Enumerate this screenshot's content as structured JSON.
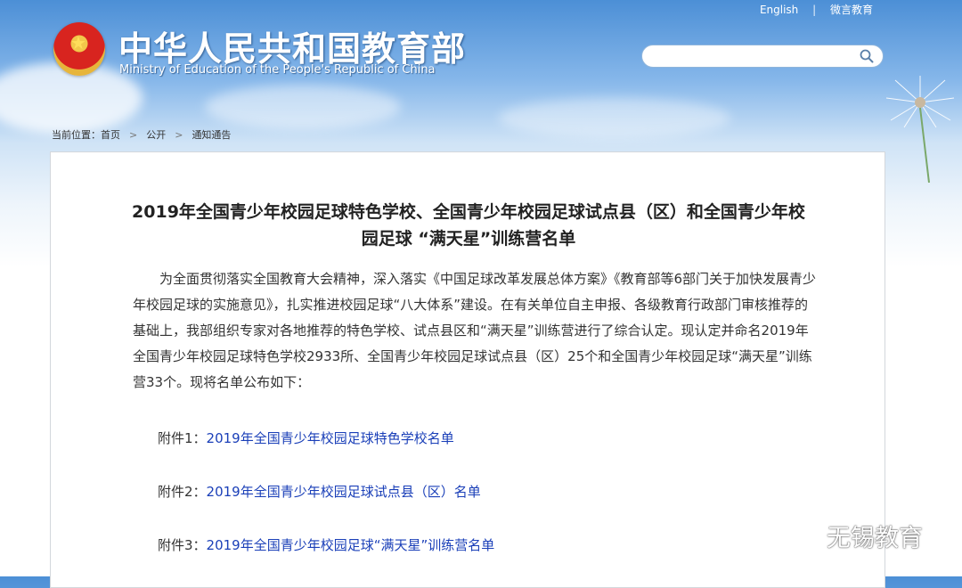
{
  "header": {
    "site_title": "中华人民共和国教育部",
    "site_subtitle": "Ministry of Education of the People's Republic of China",
    "links": {
      "english": "English",
      "weibo": "微言教育"
    },
    "search": {
      "placeholder": ""
    },
    "icons": {
      "emblem": "national-emblem-icon",
      "search": "search-icon",
      "dandelion": "dandelion-decoration"
    }
  },
  "breadcrumb": {
    "prefix": "当前位置：",
    "items": [
      "首页",
      "公开",
      "通知通告"
    ],
    "separator": ">"
  },
  "article": {
    "title_line1": "2019年全国青少年校园足球特色学校、全国青少年校园足球试点县（区）和全国青少年校",
    "title_line2": "园足球 “满天星”训练营名单",
    "paragraph": "为全面贯彻落实全国教育大会精神，深入落实《中国足球改革发展总体方案》《教育部等6部门关于加快发展青少年校园足球的实施意见》，扎实推进校园足球“八大体系”建设。在有关单位自主申报、各级教育行政部门审核推荐的基础上，我部组织专家对各地推荐的特色学校、试点县区和“满天星”训练营进行了综合认定。现认定并命名2019年全国青少年校园足球特色学校2933所、全国青少年校园足球试点县（区）25个和全国青少年校园足球“满天星”训练营33个。现将名单公布如下：",
    "attachments": [
      {
        "label": "附件1：",
        "link": "2019年全国青少年校园足球特色学校名单"
      },
      {
        "label": "附件2：",
        "link": "2019年全国青少年校园足球试点县（区）名单"
      },
      {
        "label": "附件3：",
        "link": "2019年全国青少年校园足球“满天星”训练营名单"
      }
    ]
  },
  "watermark": {
    "text": "无锡教育",
    "icon": "wechat-icon"
  },
  "colors": {
    "link": "#1a3fb8",
    "header_blue": "#4c8fd6",
    "text": "#333333"
  }
}
